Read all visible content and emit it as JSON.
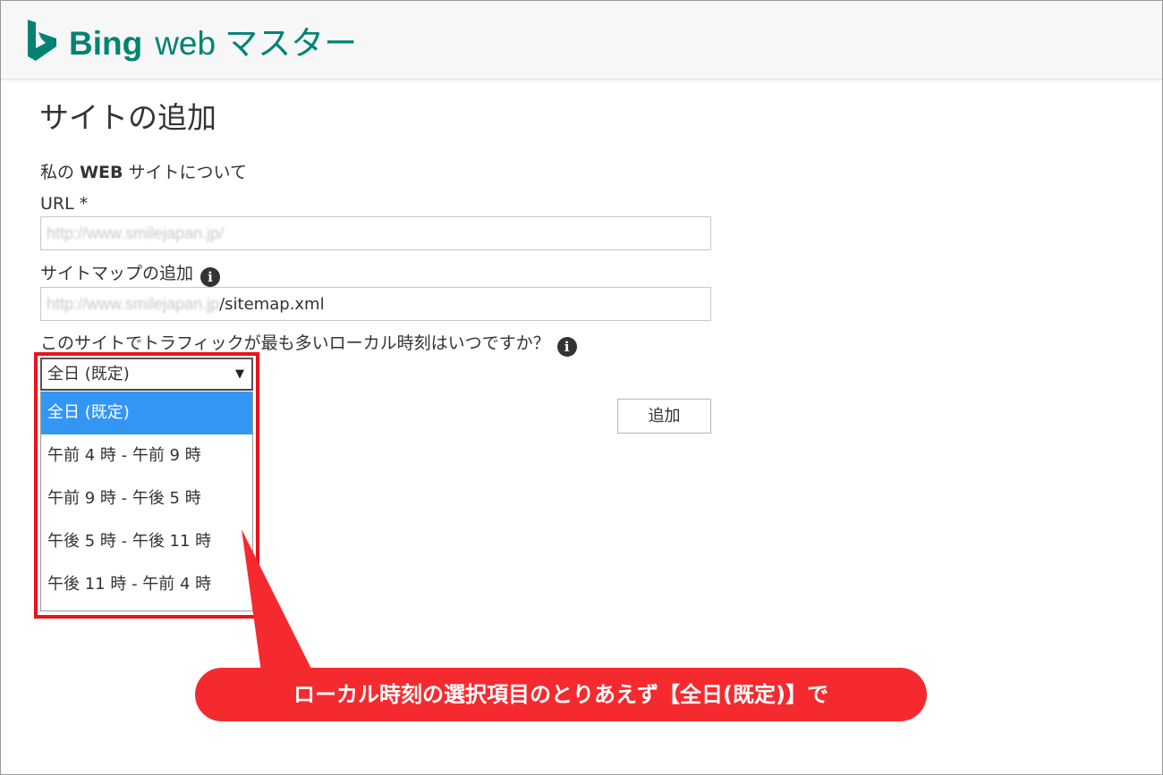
{
  "header": {
    "brand_bing": "Bing",
    "brand_web": "web",
    "brand_japanese": "マスター"
  },
  "page": {
    "title": "サイトの追加",
    "section_prefix": "私の",
    "section_bold": "WEB",
    "section_suffix": "サイトについて"
  },
  "url_field": {
    "label": "URL *",
    "value_blurred": "http://www.smilejapan.jp/"
  },
  "sitemap_field": {
    "label": "サイトマップの追加",
    "value_blurred": "http://www.smilejapan.jp",
    "value_visible": "/sitemap.xml"
  },
  "traffic_question": {
    "label": "このサイトでトラフィックが最も多いローカル時刻はいつですか？"
  },
  "time_select": {
    "selected": "全日 (既定)",
    "arrow": "▼",
    "options": [
      "全日 (既定)",
      "午前 4 時 - 午前 9 時",
      "午前 9 時 - 午後 5 時",
      "午後 5 時 - 午後 11 時",
      "午後 11 時 - 午前 4 時"
    ]
  },
  "add_button": {
    "label": "追加"
  },
  "callout": {
    "text": "ローカル時刻の選択項目のとりあえず【全日(既定)】で"
  },
  "info_icon_glyph": "i",
  "colors": {
    "brand": "#008373",
    "selected_option": "#3396f5",
    "annotation_red": "#e8141a",
    "callout_red": "#f52a2f"
  }
}
